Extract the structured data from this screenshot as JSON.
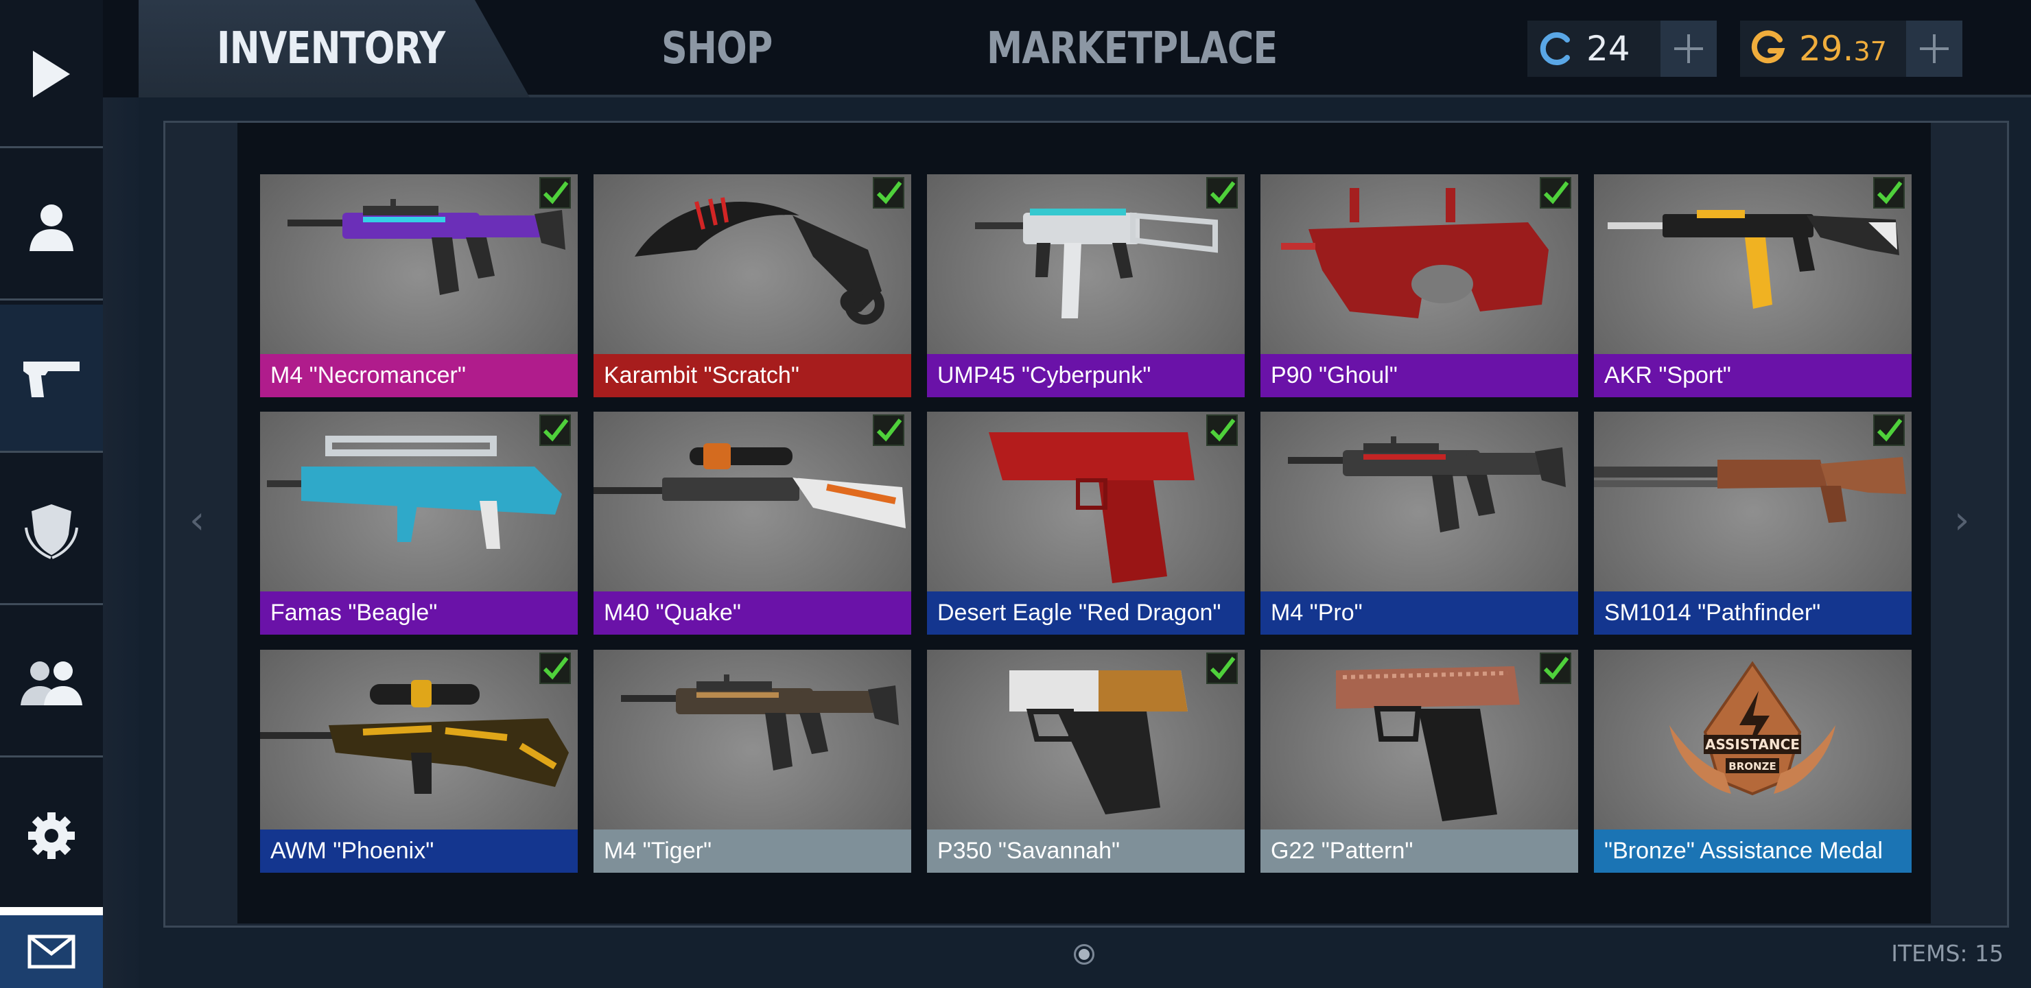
{
  "tabs": [
    {
      "label": "INVENTORY",
      "active": true
    },
    {
      "label": "SHOP",
      "active": false
    },
    {
      "label": "MARKETPLACE",
      "active": false
    }
  ],
  "currencies": {
    "credits": {
      "icon": "credits-icon",
      "value": "24",
      "color": "#5aa7e6"
    },
    "gold": {
      "icon": "gold-icon",
      "value_main": "29.",
      "value_fraction": "37",
      "color": "#f0ad3c"
    }
  },
  "sidebar": {
    "items": [
      {
        "name": "play",
        "icon": "play-icon"
      },
      {
        "name": "profile",
        "icon": "profile-icon"
      },
      {
        "name": "inventory",
        "icon": "pistol-icon",
        "active": true
      },
      {
        "name": "clan",
        "icon": "shield-icon"
      },
      {
        "name": "friends",
        "icon": "friends-icon"
      },
      {
        "name": "settings",
        "icon": "gear-icon"
      },
      {
        "name": "messages",
        "icon": "mail-icon"
      }
    ]
  },
  "rarity_colors": {
    "pink": "#b01c8c",
    "red": "#a71d1d",
    "purple": "#6a12a8",
    "blue": "#14368f",
    "gray": "#7f9099",
    "medal": "#1b74b4"
  },
  "items": [
    {
      "name": "M4 \"Necromancer\"",
      "rarity": "pink",
      "equipped": true,
      "art": "rifle-purple"
    },
    {
      "name": "Karambit \"Scratch\"",
      "rarity": "red",
      "equipped": true,
      "art": "karambit"
    },
    {
      "name": "UMP45 \"Cyberpunk\"",
      "rarity": "purple",
      "equipped": true,
      "art": "smg-white"
    },
    {
      "name": "P90 \"Ghoul\"",
      "rarity": "purple",
      "equipped": true,
      "art": "p90-red"
    },
    {
      "name": "AKR \"Sport\"",
      "rarity": "purple",
      "equipped": true,
      "art": "ak-black"
    },
    {
      "name": "Famas \"Beagle\"",
      "rarity": "purple",
      "equipped": true,
      "art": "famas-teal"
    },
    {
      "name": "M40 \"Quake\"",
      "rarity": "purple",
      "equipped": true,
      "art": "sniper-orange"
    },
    {
      "name": "Desert Eagle \"Red Dragon\"",
      "rarity": "blue",
      "equipped": true,
      "art": "deagle-red"
    },
    {
      "name": "M4 \"Pro\"",
      "rarity": "blue",
      "equipped": false,
      "art": "rifle-red"
    },
    {
      "name": "SM1014 \"Pathfinder\"",
      "rarity": "blue",
      "equipped": true,
      "art": "shotgun-brown"
    },
    {
      "name": "AWM \"Phoenix\"",
      "rarity": "blue",
      "equipped": true,
      "art": "awm-yellow"
    },
    {
      "name": "M4 \"Tiger\"",
      "rarity": "gray",
      "equipped": false,
      "art": "rifle-tiger"
    },
    {
      "name": "P350 \"Savannah\"",
      "rarity": "gray",
      "equipped": true,
      "art": "pistol-tan"
    },
    {
      "name": "G22 \"Pattern\"",
      "rarity": "gray",
      "equipped": true,
      "art": "pistol-copper"
    },
    {
      "name": "\"Bronze\" Assistance Medal",
      "rarity": "medal",
      "equipped": false,
      "art": "medal-bronze",
      "medal_text": {
        "line1": "ASSISTANCE",
        "line2": "BRONZE"
      }
    }
  ],
  "footer": {
    "items_count_label": "ITEMS: 15"
  }
}
